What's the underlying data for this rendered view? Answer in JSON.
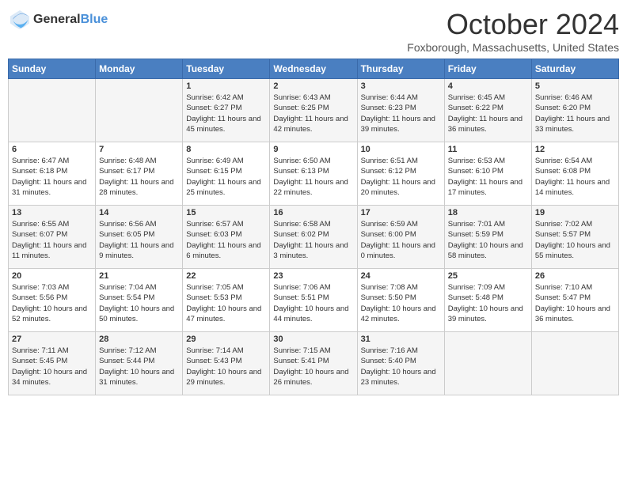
{
  "header": {
    "logo_line1": "General",
    "logo_line2": "Blue",
    "month_title": "October 2024",
    "location": "Foxborough, Massachusetts, United States"
  },
  "weekdays": [
    "Sunday",
    "Monday",
    "Tuesday",
    "Wednesday",
    "Thursday",
    "Friday",
    "Saturday"
  ],
  "weeks": [
    [
      {
        "day": "",
        "info": ""
      },
      {
        "day": "",
        "info": ""
      },
      {
        "day": "1",
        "info": "Sunrise: 6:42 AM\nSunset: 6:27 PM\nDaylight: 11 hours and 45 minutes."
      },
      {
        "day": "2",
        "info": "Sunrise: 6:43 AM\nSunset: 6:25 PM\nDaylight: 11 hours and 42 minutes."
      },
      {
        "day": "3",
        "info": "Sunrise: 6:44 AM\nSunset: 6:23 PM\nDaylight: 11 hours and 39 minutes."
      },
      {
        "day": "4",
        "info": "Sunrise: 6:45 AM\nSunset: 6:22 PM\nDaylight: 11 hours and 36 minutes."
      },
      {
        "day": "5",
        "info": "Sunrise: 6:46 AM\nSunset: 6:20 PM\nDaylight: 11 hours and 33 minutes."
      }
    ],
    [
      {
        "day": "6",
        "info": "Sunrise: 6:47 AM\nSunset: 6:18 PM\nDaylight: 11 hours and 31 minutes."
      },
      {
        "day": "7",
        "info": "Sunrise: 6:48 AM\nSunset: 6:17 PM\nDaylight: 11 hours and 28 minutes."
      },
      {
        "day": "8",
        "info": "Sunrise: 6:49 AM\nSunset: 6:15 PM\nDaylight: 11 hours and 25 minutes."
      },
      {
        "day": "9",
        "info": "Sunrise: 6:50 AM\nSunset: 6:13 PM\nDaylight: 11 hours and 22 minutes."
      },
      {
        "day": "10",
        "info": "Sunrise: 6:51 AM\nSunset: 6:12 PM\nDaylight: 11 hours and 20 minutes."
      },
      {
        "day": "11",
        "info": "Sunrise: 6:53 AM\nSunset: 6:10 PM\nDaylight: 11 hours and 17 minutes."
      },
      {
        "day": "12",
        "info": "Sunrise: 6:54 AM\nSunset: 6:08 PM\nDaylight: 11 hours and 14 minutes."
      }
    ],
    [
      {
        "day": "13",
        "info": "Sunrise: 6:55 AM\nSunset: 6:07 PM\nDaylight: 11 hours and 11 minutes."
      },
      {
        "day": "14",
        "info": "Sunrise: 6:56 AM\nSunset: 6:05 PM\nDaylight: 11 hours and 9 minutes."
      },
      {
        "day": "15",
        "info": "Sunrise: 6:57 AM\nSunset: 6:03 PM\nDaylight: 11 hours and 6 minutes."
      },
      {
        "day": "16",
        "info": "Sunrise: 6:58 AM\nSunset: 6:02 PM\nDaylight: 11 hours and 3 minutes."
      },
      {
        "day": "17",
        "info": "Sunrise: 6:59 AM\nSunset: 6:00 PM\nDaylight: 11 hours and 0 minutes."
      },
      {
        "day": "18",
        "info": "Sunrise: 7:01 AM\nSunset: 5:59 PM\nDaylight: 10 hours and 58 minutes."
      },
      {
        "day": "19",
        "info": "Sunrise: 7:02 AM\nSunset: 5:57 PM\nDaylight: 10 hours and 55 minutes."
      }
    ],
    [
      {
        "day": "20",
        "info": "Sunrise: 7:03 AM\nSunset: 5:56 PM\nDaylight: 10 hours and 52 minutes."
      },
      {
        "day": "21",
        "info": "Sunrise: 7:04 AM\nSunset: 5:54 PM\nDaylight: 10 hours and 50 minutes."
      },
      {
        "day": "22",
        "info": "Sunrise: 7:05 AM\nSunset: 5:53 PM\nDaylight: 10 hours and 47 minutes."
      },
      {
        "day": "23",
        "info": "Sunrise: 7:06 AM\nSunset: 5:51 PM\nDaylight: 10 hours and 44 minutes."
      },
      {
        "day": "24",
        "info": "Sunrise: 7:08 AM\nSunset: 5:50 PM\nDaylight: 10 hours and 42 minutes."
      },
      {
        "day": "25",
        "info": "Sunrise: 7:09 AM\nSunset: 5:48 PM\nDaylight: 10 hours and 39 minutes."
      },
      {
        "day": "26",
        "info": "Sunrise: 7:10 AM\nSunset: 5:47 PM\nDaylight: 10 hours and 36 minutes."
      }
    ],
    [
      {
        "day": "27",
        "info": "Sunrise: 7:11 AM\nSunset: 5:45 PM\nDaylight: 10 hours and 34 minutes."
      },
      {
        "day": "28",
        "info": "Sunrise: 7:12 AM\nSunset: 5:44 PM\nDaylight: 10 hours and 31 minutes."
      },
      {
        "day": "29",
        "info": "Sunrise: 7:14 AM\nSunset: 5:43 PM\nDaylight: 10 hours and 29 minutes."
      },
      {
        "day": "30",
        "info": "Sunrise: 7:15 AM\nSunset: 5:41 PM\nDaylight: 10 hours and 26 minutes."
      },
      {
        "day": "31",
        "info": "Sunrise: 7:16 AM\nSunset: 5:40 PM\nDaylight: 10 hours and 23 minutes."
      },
      {
        "day": "",
        "info": ""
      },
      {
        "day": "",
        "info": ""
      }
    ]
  ]
}
